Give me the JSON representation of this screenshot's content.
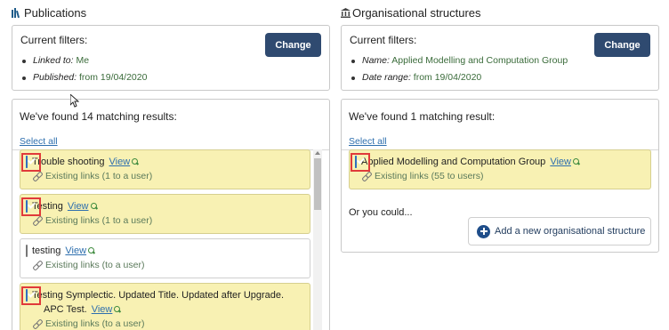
{
  "publications": {
    "title": "Publications",
    "filters_label": "Current filters:",
    "filters": [
      {
        "key": "Linked to:",
        "value": "Me"
      },
      {
        "key": "Published:",
        "value": "from 19/04/2020"
      }
    ],
    "change_label": "Change",
    "found_text": "We've found 14 matching results:",
    "select_all": "Select all",
    "items": [
      {
        "title": "Trouble shooting",
        "view": "View",
        "links": "Existing links (1 to a user)",
        "checked": true
      },
      {
        "title": "Testing",
        "view": "View",
        "links": "Existing links (1 to a user)",
        "checked": true
      },
      {
        "title": "testing",
        "view": "View",
        "links": "Existing links (to a user)",
        "checked": false
      },
      {
        "title_line1": "Testing Symplectic. Updated Title. Updated after Upgrade.",
        "title_line2": "APC Test.",
        "view": "View",
        "links": "Existing links (to a user)",
        "checked": true
      }
    ]
  },
  "org": {
    "title": "Organisational structures",
    "filters_label": "Current filters:",
    "filters": [
      {
        "key": "Name:",
        "value": "Applied Modelling and Computation Group"
      },
      {
        "key": "Date range:",
        "value": "from 19/04/2020"
      }
    ],
    "change_label": "Change",
    "found_text": "We've found 1 matching result:",
    "select_all": "Select all",
    "items": [
      {
        "title": "Applied Modelling and Computation Group",
        "view": "View",
        "links": "Existing links (55 to users)",
        "checked": true
      }
    ],
    "or_you_could": "Or you could...",
    "add_label": "Add a new organisational structure"
  },
  "colors": {
    "accent": "#2f4a70",
    "highlight": "#f8f1b3",
    "link": "#2e6fae",
    "annotation": "#e03a3a"
  }
}
